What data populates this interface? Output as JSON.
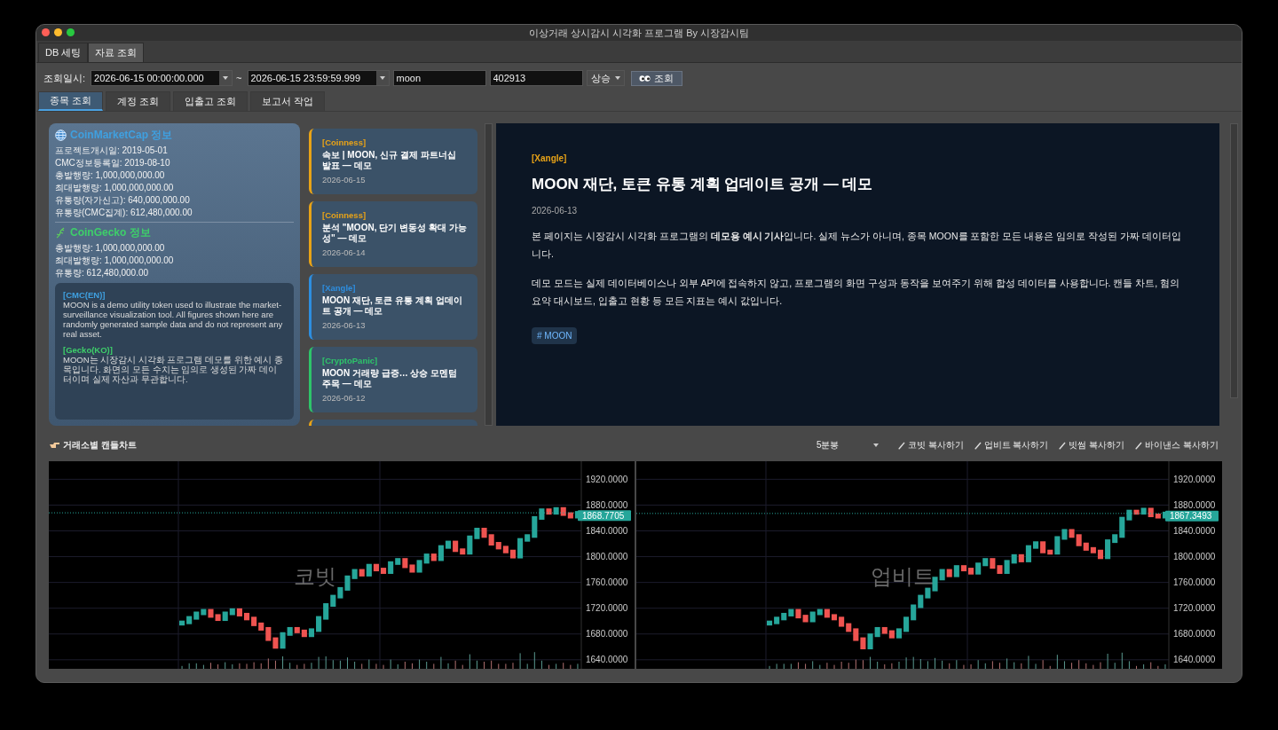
{
  "window": {
    "title": "이상거래 상시감시 시각화 프로그램 By 시장감시팀"
  },
  "main_tabs": [
    {
      "label": "DB 세팅",
      "selected": false
    },
    {
      "label": "자료 조회",
      "selected": true
    }
  ],
  "query": {
    "label": "조회일시:",
    "start": "2026-06-15 00:00:00.000",
    "separator": "~",
    "end": "2026-06-15 23:59:59.999",
    "symbol": "moon",
    "code": "402913",
    "direction": "상승",
    "button": "조회"
  },
  "sub_tabs": [
    {
      "label": "종목 조회",
      "selected": true
    },
    {
      "label": "계정 조회",
      "selected": false
    },
    {
      "label": "입출고 조회",
      "selected": false
    },
    {
      "label": "보고서 작업",
      "selected": false
    }
  ],
  "cmc": {
    "title": "CoinMarketCap 정보",
    "lines": [
      "프로젝트개시일: 2019-05-01",
      "CMC정보등록일: 2019-08-10",
      "총발행량: 1,000,000,000.00",
      "최대발행량: 1,000,000,000.00",
      "유통량(자가신고): 640,000,000.00",
      "유통량(CMC집계): 612,480,000.00"
    ]
  },
  "gecko": {
    "title": "CoinGecko 정보",
    "lines": [
      "총발행량: 1,000,000,000.00",
      "최대발행량: 1,000,000,000.00",
      "유통량: 612,480,000.00"
    ]
  },
  "descriptions": [
    {
      "heading": "[CMC(EN)]",
      "color": "#3fa0e0",
      "text": "MOON is a demo utility token used to illustrate the market-surveillance visualization tool. All figures shown here are randomly generated sample data and do not represent any real asset."
    },
    {
      "heading": "[Gecko(KO)]",
      "color": "#3ecf6a",
      "text": "MOON는 시장감시 시각화 프로그램 데모를 위한 예시 종목입니다. 화면의 모든 수치는 임의로 생성된 가짜 데이터이며 실제 자산과 무관합니다."
    }
  ],
  "news": {
    "items": [
      {
        "source": "[Coinness]",
        "title": "속보 | MOON, 신규 결제 파트너십 발표 — 데모",
        "date": "2026-06-15",
        "color": "#e8a317"
      },
      {
        "source": "[Coinness]",
        "title": "분석 \"MOON, 단기 변동성 확대 가능성\" — 데모",
        "date": "2026-06-14",
        "color": "#e8a317"
      },
      {
        "source": "[Xangle]",
        "title": "MOON 재단, 토큰 유통 계획 업데이트 공개 — 데모",
        "date": "2026-06-13",
        "color": "#2d8ee0"
      },
      {
        "source": "[CryptoPanic]",
        "title": "MOON 거래량 급증… 상승 모멘텀 주목 — 데모",
        "date": "2026-06-12",
        "color": "#2ec46a"
      }
    ],
    "partial_card": {
      "color": "#e8a317"
    }
  },
  "article": {
    "source": "[Xangle]",
    "title": "MOON 재단, 토큰 유통 계획 업데이트 공개 — 데모",
    "date": "2026-06-13",
    "paragraphs": [
      "본 페이지는 시장감시 시각화 프로그램의 **데모용 예시 기사**입니다. 실제 뉴스가 아니며, 종목 MOON를 포함한 모든 내용은 임의로 작성된 가짜 데이터입니다.",
      "데모 모드는 실제 데이터베이스나 외부 API에 접속하지 않고, 프로그램의 화면 구성과 동작을 보여주기 위해 합성 데이터를 사용합니다. 캔들 차트, 혐의 요약 대시보드, 입출고 현황 등 모든 지표는 예시 값입니다."
    ],
    "tags": [
      "# MOON"
    ]
  },
  "charts_section": {
    "title": "거래소별 캔들차트",
    "interval": "5분봉",
    "copy_buttons": [
      "코빗 복사하기",
      "업비트 복사하기",
      "빗썸 복사하기",
      "바이낸스 복사하기"
    ],
    "charts": [
      {
        "exchange": "코빗",
        "price_tag": "1868.7705",
        "y_labels": [
          "1920.0000",
          "1880.0000",
          "1840.0000",
          "1800.0000",
          "1760.0000",
          "1720.0000",
          "1680.0000",
          "1640.0000"
        ]
      },
      {
        "exchange": "업비트",
        "price_tag": "1867.3493",
        "y_labels": [
          "1920.0000",
          "1880.0000",
          "1840.0000",
          "1800.0000",
          "1760.0000",
          "1720.0000",
          "1680.0000",
          "1640.0000"
        ]
      }
    ]
  }
}
